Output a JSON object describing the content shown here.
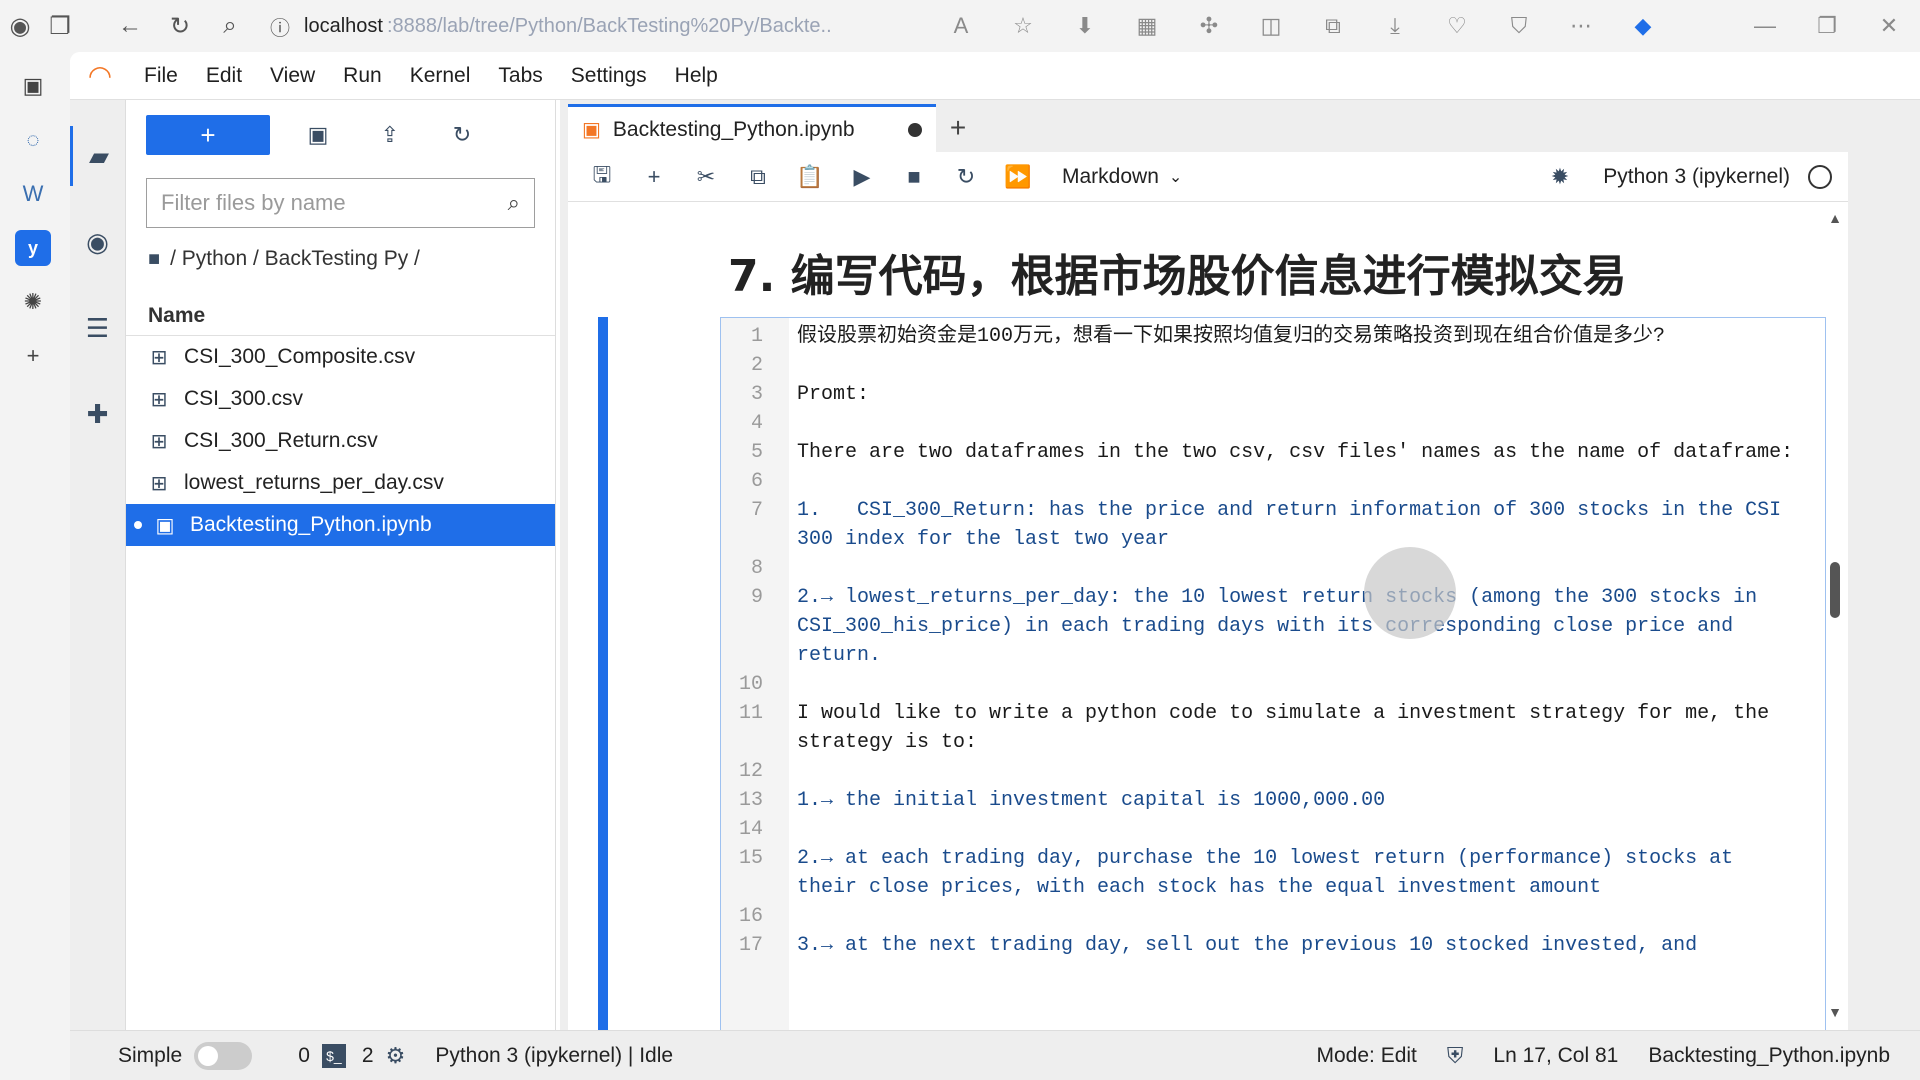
{
  "browser": {
    "host": "localhost",
    "path": ":8888/lab/tree/Python/BackTesting%20Py/Backte..."
  },
  "menubar": {
    "items": [
      "File",
      "Edit",
      "View",
      "Run",
      "Kernel",
      "Tabs",
      "Settings",
      "Help"
    ]
  },
  "filebrowser": {
    "filter_placeholder": "Filter files by name",
    "breadcrumb": "/ Python / BackTesting Py /",
    "column_header": "Name",
    "files": [
      {
        "name": "CSI_300_Composite.csv",
        "icon": "table-icon"
      },
      {
        "name": "CSI_300.csv",
        "icon": "table-icon"
      },
      {
        "name": "CSI_300_Return.csv",
        "icon": "table-icon"
      },
      {
        "name": "lowest_returns_per_day.csv",
        "icon": "table-icon"
      },
      {
        "name": "Backtesting_Python.ipynb",
        "icon": "notebook-icon",
        "selected": true
      }
    ]
  },
  "notebook": {
    "tab_title": "Backtesting_Python.ipynb",
    "cell_type": "Markdown",
    "kernel_name": "Python 3 (ipykernel)",
    "heading": "7. 编写代码，根据市场股价信息进行模拟交易",
    "lines": [
      {
        "n": "1",
        "text": "假设股票初始资金是100万元，想看一下如果按照均值复归的交易策略投资到现在组合价值是多少?",
        "style": "normal"
      },
      {
        "n": "2",
        "text": "",
        "style": "normal"
      },
      {
        "n": "3",
        "text": "Promt:",
        "style": "normal"
      },
      {
        "n": "4",
        "text": "",
        "style": "normal"
      },
      {
        "n": "5",
        "text": "There are two dataframes in the two csv, csv files' names as the name of dataframe:",
        "style": "normal"
      },
      {
        "n": "6",
        "text": "",
        "style": "normal"
      },
      {
        "n": "7",
        "text": "1.   CSI_300_Return: has the price and return information of 300 stocks in the CSI 300 index for the last two year",
        "style": "blue"
      },
      {
        "n": "8",
        "text": "",
        "style": "normal"
      },
      {
        "n": "9",
        "text": "2.→ lowest_returns_per_day: the 10 lowest return stocks (among the 300 stocks in CSI_300_his_price) in each trading days with its corresponding close price and return.",
        "style": "blue"
      },
      {
        "n": "10",
        "text": "",
        "style": "normal"
      },
      {
        "n": "11",
        "text": "I would like to write a python code to simulate a investment strategy for me, the strategy is to:",
        "style": "normal"
      },
      {
        "n": "12",
        "text": "",
        "style": "normal"
      },
      {
        "n": "13",
        "text": "1.→ the initial investment capital is 1000,000.00",
        "style": "blue"
      },
      {
        "n": "14",
        "text": "",
        "style": "normal"
      },
      {
        "n": "15",
        "text": "2.→ at each trading day, purchase the 10 lowest return (performance) stocks at their close prices, with each stock has the equal investment amount",
        "style": "blue"
      },
      {
        "n": "16",
        "text": "",
        "style": "normal"
      },
      {
        "n": "17",
        "text": "3.→ at the next trading day, sell out the previous 10 stocked invested, and",
        "style": "blue"
      }
    ]
  },
  "statusbar": {
    "simple_label": "Simple",
    "terminals": "0",
    "kernels": "2",
    "kernel_status": "Python 3 (ipykernel) | Idle",
    "mode": "Mode: Edit",
    "position": "Ln 17, Col 81",
    "filename": "Backtesting_Python.ipynb"
  },
  "colors": {
    "accent": "#1f6ee8",
    "jupyter_orange": "#f37726"
  }
}
